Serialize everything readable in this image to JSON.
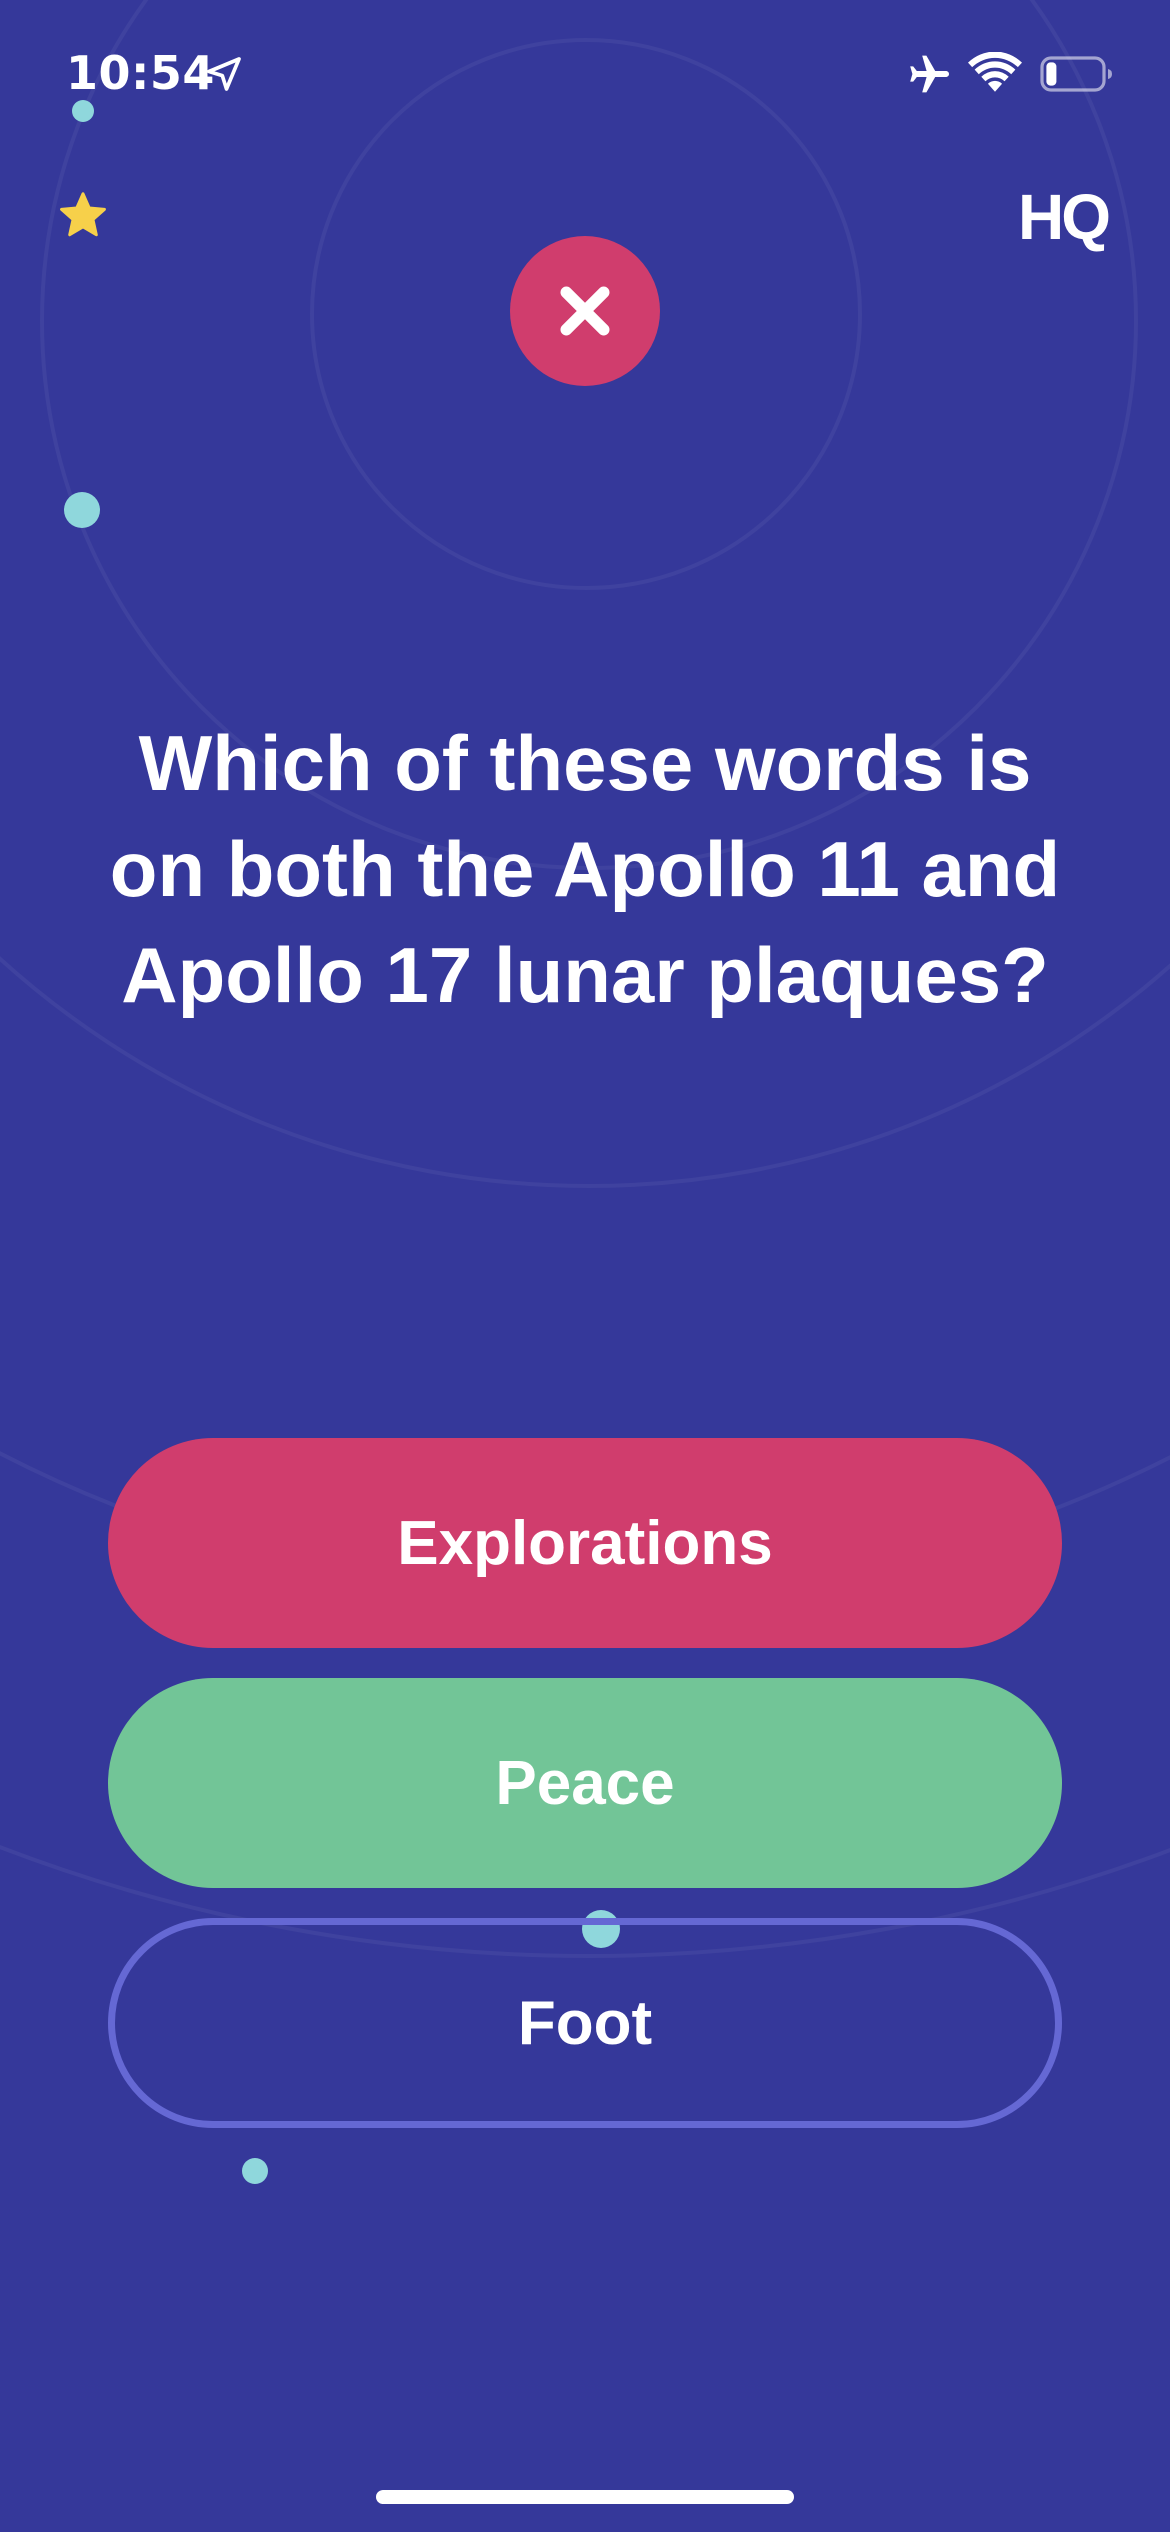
{
  "status_bar": {
    "time": "10:54",
    "icons": [
      "location-arrow-icon",
      "airplane-icon",
      "wifi-icon",
      "battery-icon"
    ]
  },
  "header": {
    "extra_life_icon": "star-icon",
    "logo": "HQ"
  },
  "result": {
    "icon": "close-icon",
    "color": "#d03d6d"
  },
  "question": {
    "text": "Which of these words is on both the Apollo 11 and Apollo 17 lunar plaques?"
  },
  "answers": [
    {
      "label": "Explorations",
      "state": "selected-wrong",
      "color": "#d03d6d"
    },
    {
      "label": "Peace",
      "state": "correct",
      "color": "#72c597"
    },
    {
      "label": "Foot",
      "state": "neutral",
      "color": "#6568d4"
    }
  ],
  "colors": {
    "background": "#35389a",
    "accent_dot": "#8fd7dc",
    "star": "#f7d04a"
  }
}
